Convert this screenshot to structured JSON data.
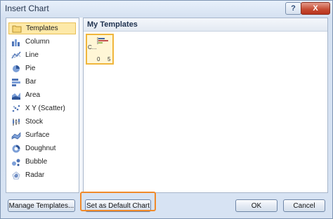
{
  "window": {
    "title": "Insert Chart",
    "help_label": "?",
    "close_label": "X"
  },
  "sidebar": {
    "items": [
      {
        "label": "Templates",
        "icon": "folder-icon",
        "selected": true
      },
      {
        "label": "Column",
        "icon": "column-chart-icon"
      },
      {
        "label": "Line",
        "icon": "line-chart-icon"
      },
      {
        "label": "Pie",
        "icon": "pie-chart-icon"
      },
      {
        "label": "Bar",
        "icon": "bar-chart-icon"
      },
      {
        "label": "Area",
        "icon": "area-chart-icon"
      },
      {
        "label": "X Y (Scatter)",
        "icon": "scatter-chart-icon"
      },
      {
        "label": "Stock",
        "icon": "stock-chart-icon"
      },
      {
        "label": "Surface",
        "icon": "surface-chart-icon"
      },
      {
        "label": "Doughnut",
        "icon": "doughnut-chart-icon"
      },
      {
        "label": "Bubble",
        "icon": "bubble-chart-icon"
      },
      {
        "label": "Radar",
        "icon": "radar-chart-icon"
      }
    ]
  },
  "main": {
    "section_title": "My Templates",
    "template": {
      "label_text": "C...",
      "axis_start": "0",
      "axis_end": "5"
    }
  },
  "buttons": {
    "manage_templates": "Manage Templates...",
    "set_default": "Set as Default Chart",
    "ok": "OK",
    "cancel": "Cancel"
  },
  "colors": {
    "selection_fill": "#fde9a8",
    "selection_border": "#f0b63c",
    "highlight": "#f08a2a",
    "close_button": "#c54a32"
  }
}
